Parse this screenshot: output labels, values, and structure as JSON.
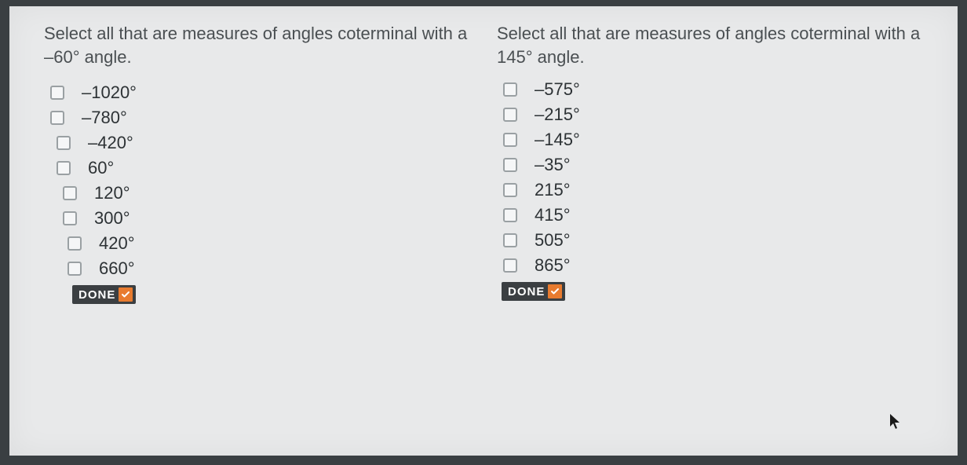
{
  "left": {
    "prompt": "Select all that are measures of angles coterminal with a –60° angle.",
    "options": [
      "–1020°",
      "–780°",
      "–420°",
      "60°",
      "120°",
      "300°",
      "420°",
      "660°"
    ],
    "done_label": "DONE"
  },
  "right": {
    "prompt": "Select all that are measures of angles coterminal with a 145° angle.",
    "options": [
      "–575°",
      "–215°",
      "–145°",
      "–35°",
      "215°",
      "415°",
      "505°",
      "865°"
    ],
    "done_label": "DONE"
  }
}
